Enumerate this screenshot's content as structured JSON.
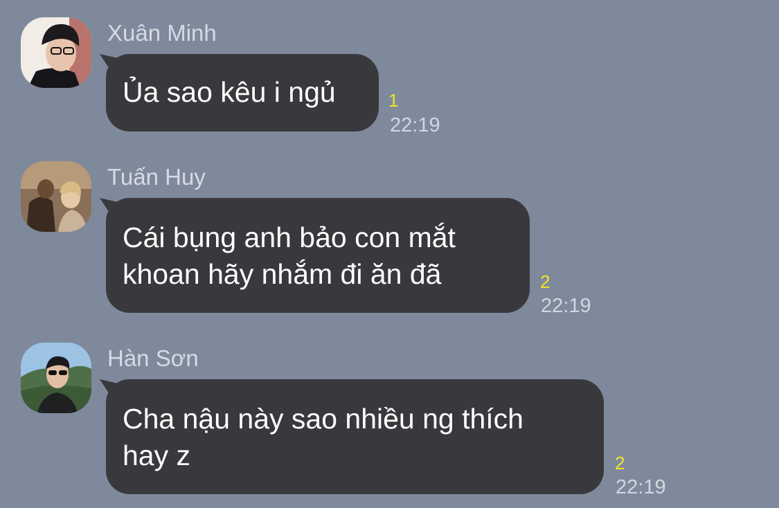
{
  "messages": [
    {
      "sender": "Xuân Minh",
      "text": "Ủa sao kêu i ngủ",
      "read_count": "1",
      "time": "22:19"
    },
    {
      "sender": "Tuấn Huy",
      "text": "Cái bụng anh bảo con mắt\nkhoan hãy nhắm đi ăn đã",
      "read_count": "2",
      "time": "22:19"
    },
    {
      "sender": "Hàn Sơn",
      "text": "Cha nậu này sao nhiều ng thích\nhay z",
      "read_count": "2",
      "time": "22:19"
    }
  ]
}
